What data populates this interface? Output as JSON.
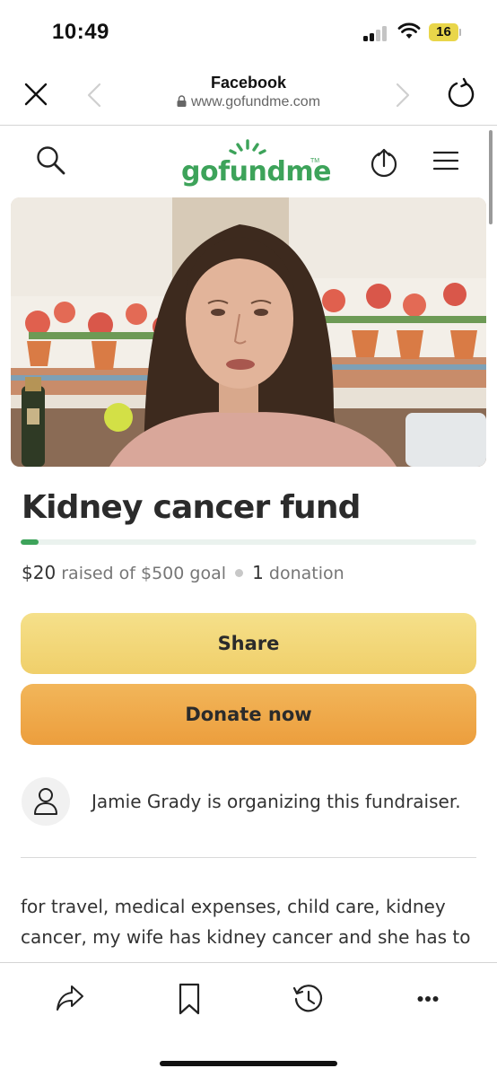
{
  "status_bar": {
    "time": "10:49",
    "battery_level": "16",
    "icons": [
      "cellular-signal-icon",
      "wifi-icon",
      "battery-icon"
    ]
  },
  "browser": {
    "title": "Facebook",
    "url": "www.gofundme.com",
    "icons": [
      "close-icon",
      "back-arrow-icon",
      "lock-icon",
      "forward-arrow-icon",
      "reload-icon"
    ]
  },
  "header": {
    "logo_text": "gofundme",
    "logo_tm": "TM",
    "icons": [
      "search-icon",
      "share-upload-icon",
      "menu-icon"
    ]
  },
  "fundraiser": {
    "title": "Kidney cancer fund",
    "raised": "$20",
    "raised_suffix": "raised of $500 goal",
    "donation_count": "1",
    "donation_label": "donation",
    "progress_fraction": 0.04
  },
  "buttons": {
    "share": "Share",
    "donate": "Donate now"
  },
  "organizer": {
    "text": "Jamie Grady is organizing this fundraiser.",
    "icon": "person-icon"
  },
  "story": {
    "text": "for travel, medical expenses, child care, kidney cancer, my wife has kidney cancer and she has to"
  },
  "toolbar": {
    "icons": [
      "share-icon",
      "bookmark-icon",
      "history-icon",
      "more-icon"
    ]
  },
  "colors": {
    "brand_green": "#3da35a",
    "share_button": "#f2d774",
    "donate_button": "#ef a84a",
    "progress_track": "#eaf2ee"
  }
}
